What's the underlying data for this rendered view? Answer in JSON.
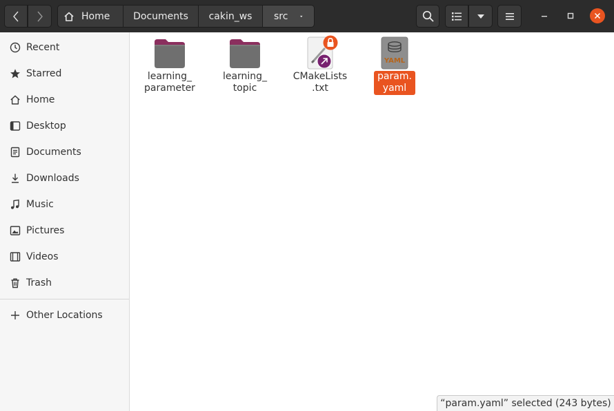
{
  "header": {
    "breadcrumbs": [
      "Home",
      "Documents",
      "cakin_ws",
      "src"
    ]
  },
  "sidebar": {
    "items": [
      {
        "label": "Recent",
        "icon": "clock-icon"
      },
      {
        "label": "Starred",
        "icon": "star-icon"
      },
      {
        "label": "Home",
        "icon": "home-icon"
      },
      {
        "label": "Desktop",
        "icon": "desktop-icon"
      },
      {
        "label": "Documents",
        "icon": "document-icon"
      },
      {
        "label": "Downloads",
        "icon": "download-icon"
      },
      {
        "label": "Music",
        "icon": "music-icon"
      },
      {
        "label": "Pictures",
        "icon": "picture-icon"
      },
      {
        "label": "Videos",
        "icon": "video-icon"
      },
      {
        "label": "Trash",
        "icon": "trash-icon"
      }
    ],
    "other_locations": "Other Locations"
  },
  "files": [
    {
      "line1": "learning_",
      "line2": "parameter",
      "type": "folder",
      "selected": false
    },
    {
      "line1": "learning_",
      "line2": "topic",
      "type": "folder",
      "selected": false
    },
    {
      "line1": "CMakeLists",
      "line2": ".txt",
      "type": "locked-symlink-text",
      "selected": false
    },
    {
      "line1": "param.",
      "line2": "yaml",
      "type": "yaml",
      "selected": true
    }
  ],
  "yaml_icon_text": "YAML",
  "status": "“param.yaml” selected  (243 bytes)",
  "colors": {
    "accent": "#e95420",
    "header_bg": "#2c2c2c",
    "folder": "#6f6f6f",
    "folder_tab": "#8b2f5e"
  }
}
